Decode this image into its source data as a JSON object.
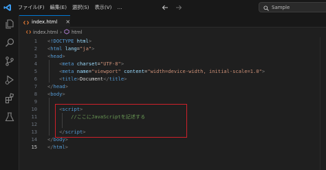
{
  "menu": {
    "items": [
      "ファイル(F)",
      "編集(E)",
      "選択(S)",
      "表示(V)"
    ],
    "more": "…"
  },
  "search": {
    "text": "Sample"
  },
  "tab": {
    "label": "index.html",
    "close": "×"
  },
  "breadcrumb": {
    "file": "index.html",
    "separator": "›",
    "element": "html"
  },
  "editor": {
    "lines": [
      {
        "n": "1",
        "tokens": [
          [
            "punc",
            "<"
          ],
          [
            "tag",
            "!DOCTYPE"
          ],
          [
            "txt",
            " "
          ],
          [
            "attr",
            "html"
          ],
          [
            "punc",
            ">"
          ]
        ]
      },
      {
        "n": "2",
        "tokens": [
          [
            "punc",
            "<"
          ],
          [
            "tag",
            "html"
          ],
          [
            "txt",
            " "
          ],
          [
            "attr",
            "lang"
          ],
          [
            "txt",
            "="
          ],
          [
            "str",
            "\"ja\""
          ],
          [
            "punc",
            ">"
          ]
        ]
      },
      {
        "n": "3",
        "tokens": [
          [
            "punc",
            "<"
          ],
          [
            "tag",
            "head"
          ],
          [
            "punc",
            ">"
          ]
        ]
      },
      {
        "n": "4",
        "tokens": [
          [
            "txt",
            "    "
          ],
          [
            "punc",
            "<"
          ],
          [
            "tag",
            "meta"
          ],
          [
            "txt",
            " "
          ],
          [
            "attr",
            "charset"
          ],
          [
            "txt",
            "="
          ],
          [
            "str",
            "\"UTF-8\""
          ],
          [
            "punc",
            ">"
          ]
        ]
      },
      {
        "n": "5",
        "tokens": [
          [
            "txt",
            "    "
          ],
          [
            "punc",
            "<"
          ],
          [
            "tag",
            "meta"
          ],
          [
            "txt",
            " "
          ],
          [
            "attr",
            "name"
          ],
          [
            "txt",
            "="
          ],
          [
            "str",
            "\"viewport\""
          ],
          [
            "txt",
            " "
          ],
          [
            "attr",
            "content"
          ],
          [
            "txt",
            "="
          ],
          [
            "str",
            "\"width=device-width, initial-scale=1.0\""
          ],
          [
            "punc",
            ">"
          ]
        ]
      },
      {
        "n": "6",
        "tokens": [
          [
            "txt",
            "    "
          ],
          [
            "punc",
            "<"
          ],
          [
            "tag",
            "title"
          ],
          [
            "punc",
            ">"
          ],
          [
            "txt",
            "Document"
          ],
          [
            "punc",
            "</"
          ],
          [
            "tag",
            "title"
          ],
          [
            "punc",
            ">"
          ]
        ]
      },
      {
        "n": "7",
        "tokens": [
          [
            "punc",
            "</"
          ],
          [
            "tag",
            "head"
          ],
          [
            "punc",
            ">"
          ]
        ]
      },
      {
        "n": "8",
        "tokens": [
          [
            "punc",
            "<"
          ],
          [
            "tag",
            "body"
          ],
          [
            "punc",
            ">"
          ]
        ]
      },
      {
        "n": "9",
        "tokens": []
      },
      {
        "n": "10",
        "tokens": [
          [
            "txt",
            "    "
          ],
          [
            "punc",
            "<"
          ],
          [
            "tag",
            "script"
          ],
          [
            "punc",
            ">"
          ]
        ]
      },
      {
        "n": "11",
        "tokens": [
          [
            "txt",
            "        "
          ],
          [
            "cmt",
            "//ここにJavaScriptを記述する"
          ]
        ]
      },
      {
        "n": "12",
        "tokens": []
      },
      {
        "n": "13",
        "tokens": [
          [
            "txt",
            "    "
          ],
          [
            "punc",
            "</"
          ],
          [
            "tag",
            "script"
          ],
          [
            "punc",
            ">"
          ]
        ]
      },
      {
        "n": "14",
        "tokens": [
          [
            "punc",
            "</"
          ],
          [
            "tag",
            "body"
          ],
          [
            "punc",
            ">"
          ]
        ]
      },
      {
        "n": "15",
        "tokens": [
          [
            "punc",
            "</"
          ],
          [
            "tag",
            "html"
          ],
          [
            "punc",
            ">"
          ]
        ]
      }
    ],
    "active_line": "15"
  },
  "colors": {
    "accent": "#0078d4",
    "highlight_box": "#d0202a",
    "html_icon": "#e37933"
  }
}
